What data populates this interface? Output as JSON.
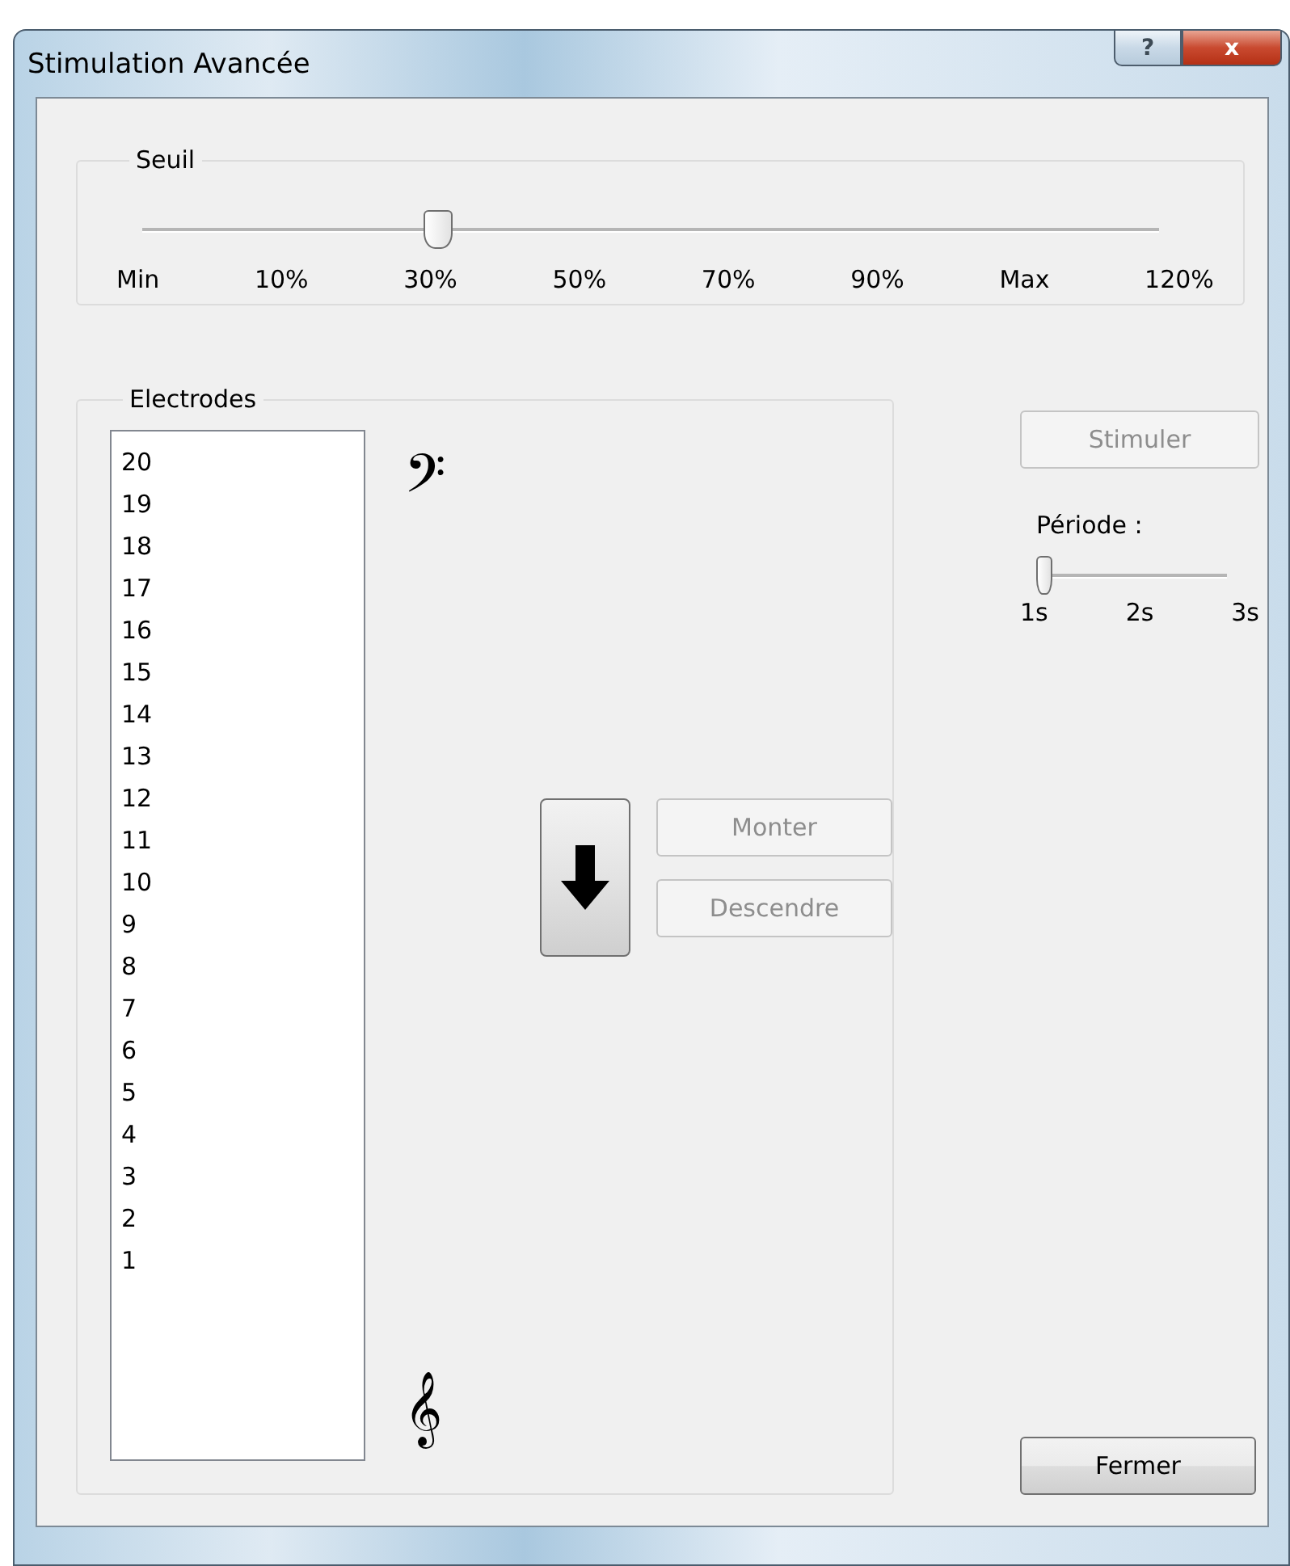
{
  "window": {
    "title": "Stimulation Avancée",
    "help_button": "?",
    "close_button": "x"
  },
  "threshold": {
    "label": "Seuil",
    "level": 0.284,
    "ticks": [
      "Min",
      "10%",
      "30%",
      "50%",
      "70%",
      "90%",
      "Max",
      "120%"
    ]
  },
  "electrodes": {
    "label": "Electrodes",
    "bass_clef": "𝄢",
    "treble_clef": "𝄞",
    "items": [
      {
        "label": "20",
        "selected": false
      },
      {
        "label": "19",
        "selected": false
      },
      {
        "label": "18",
        "selected": false
      },
      {
        "label": "17",
        "selected": false
      },
      {
        "label": "16",
        "selected": false
      },
      {
        "label": "15",
        "selected": false
      },
      {
        "label": "14",
        "selected": false
      },
      {
        "label": "13",
        "selected": false
      },
      {
        "label": "12",
        "selected": false
      },
      {
        "label": "11",
        "selected": false
      },
      {
        "label": "10",
        "selected": false
      },
      {
        "label": "9",
        "selected": false
      },
      {
        "label": "8",
        "selected": false
      },
      {
        "label": "7",
        "selected": false
      },
      {
        "label": "6",
        "selected": false
      },
      {
        "label": "5",
        "selected": false
      },
      {
        "label": "4",
        "selected": false
      },
      {
        "label": "3",
        "selected": false
      },
      {
        "label": "2",
        "selected": false
      },
      {
        "label": "1",
        "selected": false
      }
    ],
    "up_button": {
      "label": "Monter",
      "disabled": true
    },
    "down_button": {
      "label": "Descendre",
      "disabled": true
    }
  },
  "stimulate_button": {
    "label": "Stimuler",
    "disabled": true
  },
  "period": {
    "label": "Période :",
    "level": 0,
    "ticks": [
      "1s",
      "2s",
      "3s"
    ]
  },
  "close_dialog_button": {
    "label": "Fermer",
    "disabled": false
  }
}
